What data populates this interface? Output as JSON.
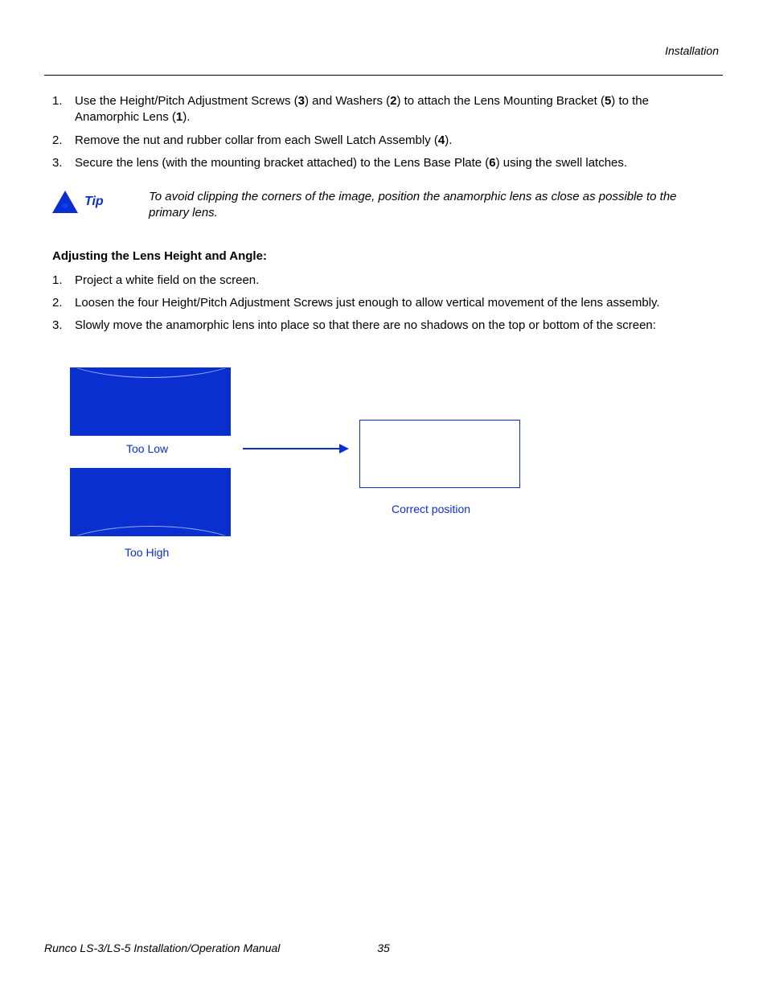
{
  "header": {
    "section": "Installation"
  },
  "steps_a": [
    {
      "pre": "Use the Height/Pitch Adjustment Screws (",
      "b1": "3",
      "mid1": ") and Washers (",
      "b2": "2",
      "mid2": ") to attach the Lens Mounting Bracket (",
      "b3": "5",
      "mid3": ") to the Anamorphic Lens (",
      "b4": "1",
      "post": ")."
    },
    {
      "pre": "Remove the nut and rubber collar from each Swell Latch Assembly (",
      "b1": "4",
      "post": ")."
    },
    {
      "pre": "Secure the lens (with the mounting bracket attached) to the Lens Base Plate (",
      "b1": "6",
      "post": ") using the swell latches."
    }
  ],
  "tip": {
    "label": "Tip",
    "text": "To avoid clipping the corners of the image, position the anamorphic lens as close as possible to the primary lens."
  },
  "subhead": "Adjusting the Lens Height and Angle:",
  "steps_b": [
    "Project a white field on the screen.",
    "Loosen the four Height/Pitch Adjustment Screws just enough to allow vertical movement of the lens assembly.",
    "Slowly move the anamorphic lens into place so that there are no shadows on the top or bottom of the screen:"
  ],
  "diagram": {
    "too_low": "Too Low",
    "too_high": "Too High",
    "correct": "Correct position"
  },
  "footer": {
    "title": "Runco LS-3/LS-5 Installation/Operation Manual",
    "page": "35"
  }
}
